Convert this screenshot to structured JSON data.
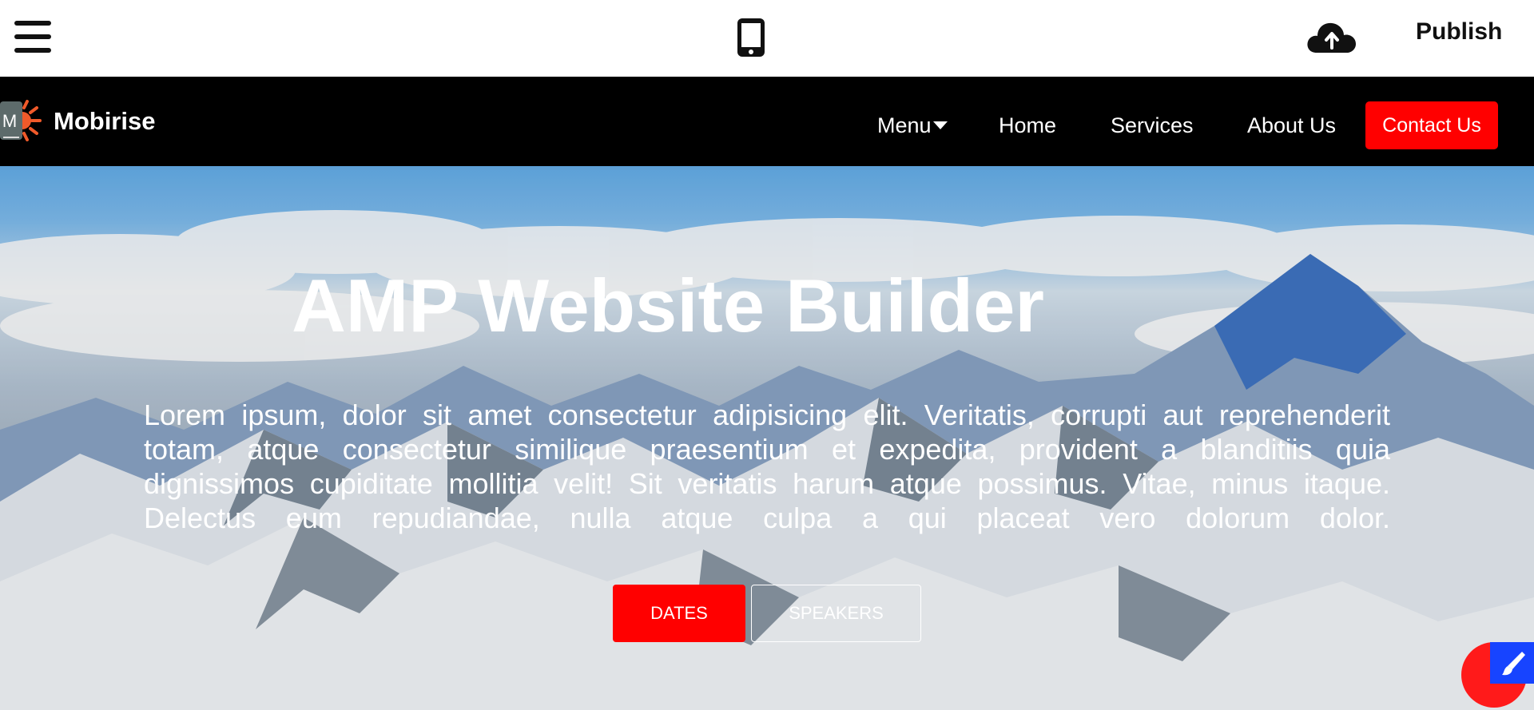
{
  "editor_bar": {
    "publish_label": "Publish",
    "icons": [
      "hamburger-menu-icon",
      "mobile-phone-icon",
      "cloud-upload-icon"
    ]
  },
  "navbar": {
    "brand_name": "Mobirise",
    "brand_logo_letter": "M",
    "items": [
      {
        "label": "Menu"
      },
      {
        "label": "Home"
      },
      {
        "label": "Services"
      },
      {
        "label": "About Us"
      }
    ],
    "cta_label": "Contact Us"
  },
  "hero": {
    "title": "AMP Website Builder",
    "paragraph_lines": [
      "Lorem ipsum, dolor sit amet consectetur adipisicing elit. Veritatis, corrupti aut reprehenderit",
      "totam, atque consectetur similique praesentium et expedita, provident a blanditiis quia",
      "dignissimos cupiditate mollitia velit! Sit veritatis harum atque possimus. Vitae, minus itaque.",
      "Delectus eum repudiandae, nulla atque culpa a qui placeat vero dolorum dolor."
    ],
    "primary_button": "DATES",
    "secondary_button": "SPEAKERS"
  },
  "colors": {
    "accent": "#ff0000",
    "navbar_bg": "#000000",
    "style_button": "#1744ff"
  }
}
